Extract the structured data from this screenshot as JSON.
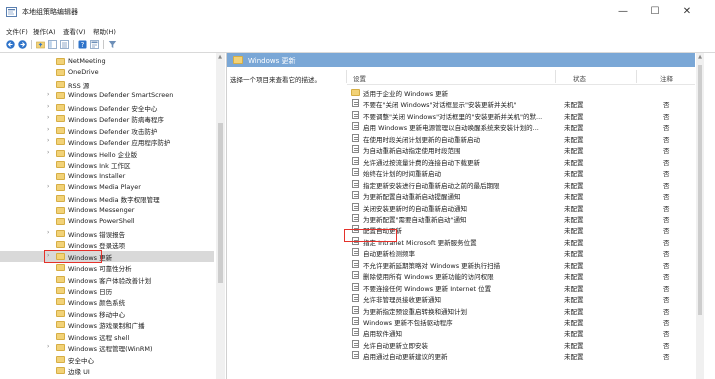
{
  "window": {
    "title": "本地组策略编辑器",
    "controls": {
      "minimize": "—",
      "maximize": "☐",
      "close": "✕"
    }
  },
  "menu": [
    "文件(F)",
    "操作(A)",
    "查看(V)",
    "帮助(H)"
  ],
  "toolbar_icons": [
    "back-icon",
    "forward-icon",
    "up-folder-icon",
    "show-hide-tree-icon",
    "export-list-icon",
    "help-icon",
    "properties-icon",
    "filter-icon"
  ],
  "tree": {
    "items": [
      {
        "label": "NetMeeting",
        "expandable": false
      },
      {
        "label": "OneDrive",
        "expandable": false
      },
      {
        "label": "RSS 源",
        "expandable": false
      },
      {
        "label": "Windows Defender SmartScreen",
        "expandable": true
      },
      {
        "label": "Windows Defender 安全中心",
        "expandable": true
      },
      {
        "label": "Windows Defender 防病毒程序",
        "expandable": true
      },
      {
        "label": "Windows Defender 攻击防护",
        "expandable": true
      },
      {
        "label": "Windows Defender 应用程序防护",
        "expandable": true
      },
      {
        "label": "Windows Hello 企业版",
        "expandable": true
      },
      {
        "label": "Windows Ink 工作区",
        "expandable": false
      },
      {
        "label": "Windows Installer",
        "expandable": false
      },
      {
        "label": "Windows Media Player",
        "expandable": true
      },
      {
        "label": "Windows Media 数字权限管理",
        "expandable": false
      },
      {
        "label": "Windows Messenger",
        "expandable": false
      },
      {
        "label": "Windows PowerShell",
        "expandable": false
      },
      {
        "label": "Windows 错误报告",
        "expandable": true
      },
      {
        "label": "Windows 登录选项",
        "expandable": false
      },
      {
        "label": "Windows 更新",
        "expandable": true,
        "selected": true
      },
      {
        "label": "Windows 可靠性分析",
        "expandable": false
      },
      {
        "label": "Windows 客户体验改善计划",
        "expandable": false
      },
      {
        "label": "Windows 日历",
        "expandable": false
      },
      {
        "label": "Windows 颜色系统",
        "expandable": false
      },
      {
        "label": "Windows 移动中心",
        "expandable": false
      },
      {
        "label": "Windows 游戏录制和广播",
        "expandable": false
      },
      {
        "label": "Windows 远程 shell",
        "expandable": false
      },
      {
        "label": "Windows 远程管理(WinRM)",
        "expandable": true
      },
      {
        "label": "安全中心",
        "expandable": false
      },
      {
        "label": "边缘 UI",
        "expandable": false
      }
    ]
  },
  "details": {
    "header": "Windows 更新",
    "description_prompt": "选择一个项目来查看它的描述。",
    "columns": {
      "setting": "设置",
      "state": "状态",
      "note": "注释"
    },
    "rows": [
      {
        "name": "适用于企业的 Windows 更新",
        "state": "",
        "note": "",
        "folder": true
      },
      {
        "name": "不要在\"关闭 Windows\"对话框显示\"安装更新并关机\"",
        "state": "未配置",
        "note": "否"
      },
      {
        "name": "不要调整\"关闭 Windows\"对话框里的\"安装更新并关机\"的默...",
        "state": "未配置",
        "note": "否"
      },
      {
        "name": "启用 Windows 更新电源管理以自动唤醒系统来安装计划的...",
        "state": "未配置",
        "note": "否"
      },
      {
        "name": "在使用时段关闭计划更新的自动重新启动",
        "state": "未配置",
        "note": "否"
      },
      {
        "name": "为自动重新启动指定使用时段范围",
        "state": "未配置",
        "note": "否"
      },
      {
        "name": "允许通过按流量计费的连接自动下载更新",
        "state": "未配置",
        "note": "否"
      },
      {
        "name": "始终在计划的时间重新启动",
        "state": "未配置",
        "note": "否"
      },
      {
        "name": "指定更新安装进行自动重新启动之前的最后期限",
        "state": "未配置",
        "note": "否"
      },
      {
        "name": "为更新配置自动重新启动提醒通知",
        "state": "未配置",
        "note": "否"
      },
      {
        "name": "关闭安装更新时的自动重新启动通知",
        "state": "未配置",
        "note": "否"
      },
      {
        "name": "为更新配置\"需要自动重新启动\"通知",
        "state": "未配置",
        "note": "否"
      },
      {
        "name": "配置自动更新",
        "state": "未配置",
        "note": "否",
        "highlighted": true
      },
      {
        "name": "指定 Intranet Microsoft 更新服务位置",
        "state": "未配置",
        "note": "否"
      },
      {
        "name": "自动更新检测频率",
        "state": "未配置",
        "note": "否"
      },
      {
        "name": "不允许更新延期策略对 Windows 更新执行扫描",
        "state": "未配置",
        "note": "否"
      },
      {
        "name": "删除使用所有 Windows 更新功能的访问权限",
        "state": "未配置",
        "note": "否"
      },
      {
        "name": "不要连接任何 Windows 更新 Internet 位置",
        "state": "未配置",
        "note": "否"
      },
      {
        "name": "允许非管理员接收更新通知",
        "state": "未配置",
        "note": "否"
      },
      {
        "name": "为更新指定预设重启转换和通知计划",
        "state": "未配置",
        "note": "否"
      },
      {
        "name": "Windows 更新不包括驱动程序",
        "state": "未配置",
        "note": "否"
      },
      {
        "name": "启用软件通知",
        "state": "未配置",
        "note": "否"
      },
      {
        "name": "允许自动更新立即安装",
        "state": "未配置",
        "note": "否"
      },
      {
        "name": "启用通过自动更新建议的更新",
        "state": "未配置",
        "note": "否"
      }
    ]
  },
  "colors": {
    "pane_header": "#7aa7d6",
    "highlight_box": "#e4322b",
    "folder": "#f2d277"
  }
}
